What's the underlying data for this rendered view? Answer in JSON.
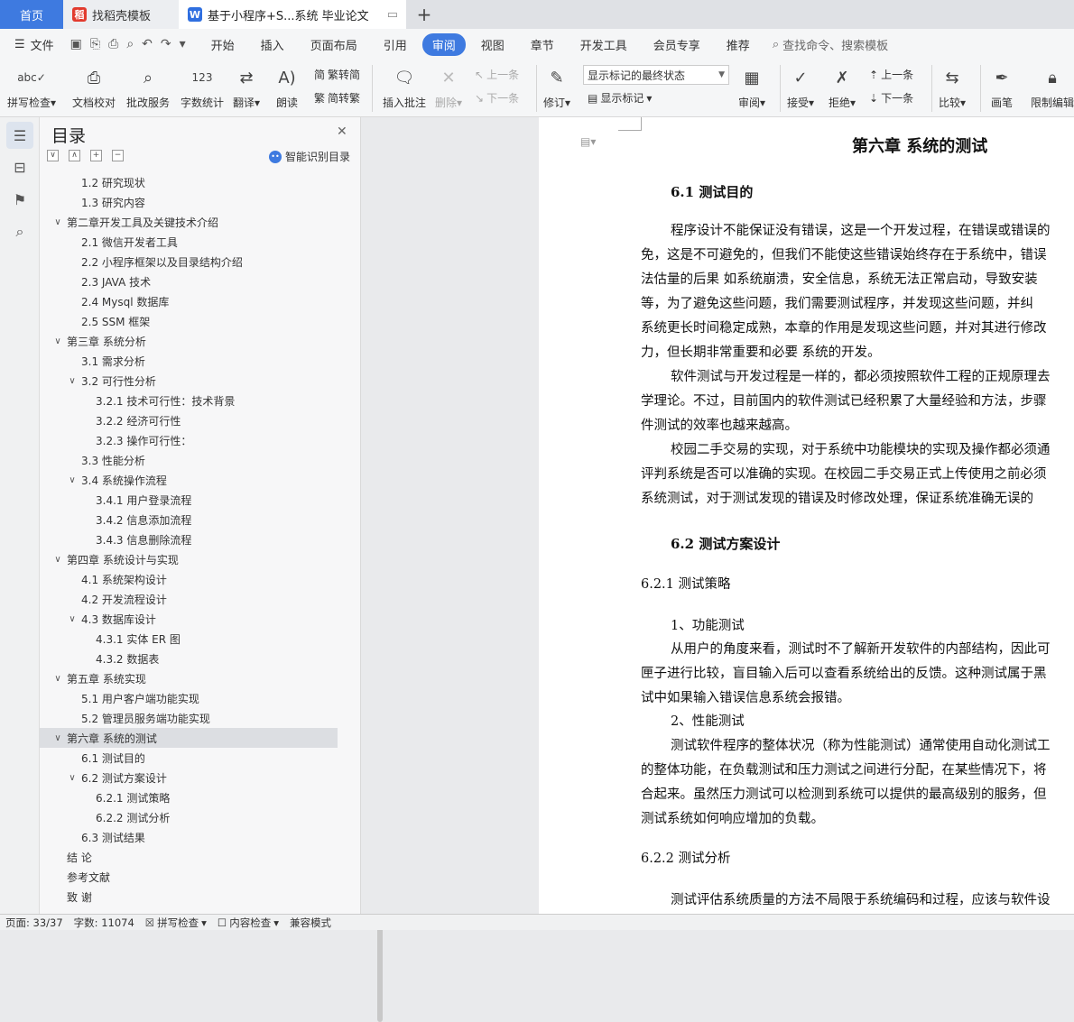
{
  "tabs": {
    "home": "首页",
    "template": "找稻壳模板",
    "document": "基于小程序+S...系统 毕业论文"
  },
  "menu": {
    "file": "文件",
    "items": [
      "开始",
      "插入",
      "页面布局",
      "引用",
      "审阅",
      "视图",
      "章节",
      "开发工具",
      "会员专享",
      "推荐"
    ],
    "active_item": "审阅",
    "search": "查找命令、搜索模板"
  },
  "toolbar": {
    "spellcheck": "拼写检查",
    "doc_check": "文档校对",
    "batch_service": "批改服务",
    "word_count": "字数统计",
    "translate": "翻译",
    "read_aloud": "朗读",
    "trad_simp": "繁转简",
    "simp_trad": "简转繁",
    "insert_comment": "插入批注",
    "delete": "删除",
    "prev_comment": "上一条",
    "next_comment": "下一条",
    "revise": "修订",
    "markup_state": "显示标记的最终状态",
    "show_markup": "显示标记",
    "review": "审阅",
    "accept": "接受",
    "reject": "拒绝",
    "prev_change": "上一条",
    "next_change": "下一条",
    "compare": "比较",
    "pen": "画笔",
    "restrict": "限制编辑"
  },
  "toc": {
    "title": "目录",
    "smart": "智能识别目录",
    "items": [
      {
        "text": "1.2 研究现状",
        "level": 2,
        "caret": ""
      },
      {
        "text": "1.3 研究内容",
        "level": 2,
        "caret": ""
      },
      {
        "text": "第二章开发工具及关键技术介绍",
        "level": 1,
        "caret": "∨"
      },
      {
        "text": "2.1 微信开发者工具",
        "level": 2,
        "caret": ""
      },
      {
        "text": "2.2 小程序框架以及目录结构介绍",
        "level": 2,
        "caret": ""
      },
      {
        "text": "2.3 JAVA 技术",
        "level": 2,
        "caret": ""
      },
      {
        "text": "2.4    Mysql 数据库",
        "level": 2,
        "caret": ""
      },
      {
        "text": "2.5 SSM 框架",
        "level": 2,
        "caret": ""
      },
      {
        "text": "第三章  系统分析",
        "level": 1,
        "caret": "∨"
      },
      {
        "text": "3.1 需求分析",
        "level": 2,
        "caret": ""
      },
      {
        "text": "3.2 可行性分析",
        "level": 2,
        "caret": "∨"
      },
      {
        "text": "3.2.1 技术可行性：技术背景",
        "level": 3,
        "caret": ""
      },
      {
        "text": "3.2.2 经济可行性",
        "level": 3,
        "caret": ""
      },
      {
        "text": "3.2.3 操作可行性：",
        "level": 3,
        "caret": ""
      },
      {
        "text": "3.3 性能分析",
        "level": 2,
        "caret": ""
      },
      {
        "text": "3.4 系统操作流程",
        "level": 2,
        "caret": "∨"
      },
      {
        "text": "3.4.1 用户登录流程",
        "level": 3,
        "caret": ""
      },
      {
        "text": "3.4.2 信息添加流程",
        "level": 3,
        "caret": ""
      },
      {
        "text": "3.4.3 信息删除流程",
        "level": 3,
        "caret": ""
      },
      {
        "text": "第四章  系统设计与实现",
        "level": 1,
        "caret": "∨"
      },
      {
        "text": "4.1 系统架构设计",
        "level": 2,
        "caret": ""
      },
      {
        "text": "4.2 开发流程设计",
        "level": 2,
        "caret": ""
      },
      {
        "text": "4.3 数据库设计",
        "level": 2,
        "caret": "∨"
      },
      {
        "text": "4.3.1 实体 ER 图",
        "level": 3,
        "caret": ""
      },
      {
        "text": "4.3.2 数据表",
        "level": 3,
        "caret": ""
      },
      {
        "text": "第五章  系统实现",
        "level": 1,
        "caret": "∨"
      },
      {
        "text": "5.1 用户客户端功能实现",
        "level": 2,
        "caret": ""
      },
      {
        "text": "5.2  管理员服务端功能实现",
        "level": 2,
        "caret": ""
      },
      {
        "text": "第六章    系统的测试",
        "level": 1,
        "caret": "∨",
        "active": true
      },
      {
        "text": "6.1  测试目的",
        "level": 2,
        "caret": ""
      },
      {
        "text": "6.2  测试方案设计",
        "level": 2,
        "caret": "∨"
      },
      {
        "text": "6.2.1  测试策略",
        "level": 3,
        "caret": ""
      },
      {
        "text": "6.2.2  测试分析",
        "level": 3,
        "caret": ""
      },
      {
        "text": "6.3  测试结果",
        "level": 2,
        "caret": ""
      },
      {
        "text": "结    论",
        "level": 1,
        "caret": ""
      },
      {
        "text": "参考文献",
        "level": 1,
        "caret": ""
      },
      {
        "text": "致    谢",
        "level": 1,
        "caret": ""
      }
    ]
  },
  "document": {
    "chapter": "第六章    系统的测试",
    "sec61": "6.1  测试目的",
    "p1": [
      "程序设计不能保证没有错误，这是一个开发过程，在错误或错误的",
      "免，这是不可避免的，但我们不能使这些错误始终存在于系统中，错误",
      "法估量的后果 如系统崩溃，安全信息，系统无法正常启动，导致安装",
      "等，为了避免这些问题，我们需要测试程序，并发现这些问题，并纠",
      "系统更长时间稳定成熟，本章的作用是发现这些问题，并对其进行修改",
      "力，但长期非常重要和必要  系统的开发。"
    ],
    "p2": [
      "软件测试与开发过程是一样的，都必须按照软件工程的正规原理去",
      "学理论。不过，目前国内的软件测试已经积累了大量经验和方法，步骤",
      "件测试的效率也越来越高。"
    ],
    "p3": [
      "校园二手交易的实现，对于系统中功能模块的实现及操作都必须通",
      "评判系统是否可以准确的实现。在校园二手交易正式上传使用之前必须",
      "系统测试，对于测试发现的错误及时修改处理，保证系统准确无误的"
    ],
    "sec62": "6.2  测试方案设计",
    "sec621": "6.2.1  测试策略",
    "func_title": "1、功能测试",
    "p4": [
      "从用户的角度来看，测试时不了解新开发软件的内部结构，因此可",
      "匣子进行比较，盲目输入后可以查看系统给出的反馈。这种测试属于黑",
      "试中如果输入错误信息系统会报错。"
    ],
    "perf_title": "2、性能测试",
    "p5": [
      "测试软件程序的整体状况（称为性能测试）通常使用自动化测试工",
      "的整体功能，在负载测试和压力测试之间进行分配，在某些情况下，将",
      "合起来。虽然压力测试可以检测到系统可以提供的最高级别的服务，但",
      "测试系统如何响应增加的负载。"
    ],
    "sec622": "6.2.2  测试分析",
    "p6": "测试评估系统质量的方法不局限于系统编码和过程，应该与软件设"
  },
  "status": {
    "page": "页面: 33/37",
    "words": "字数: 11074",
    "spellcheck": "拼写检查",
    "content_check": "内容检查",
    "compat": "兼容模式"
  },
  "colors": {
    "accent": "#3e7ae0"
  }
}
